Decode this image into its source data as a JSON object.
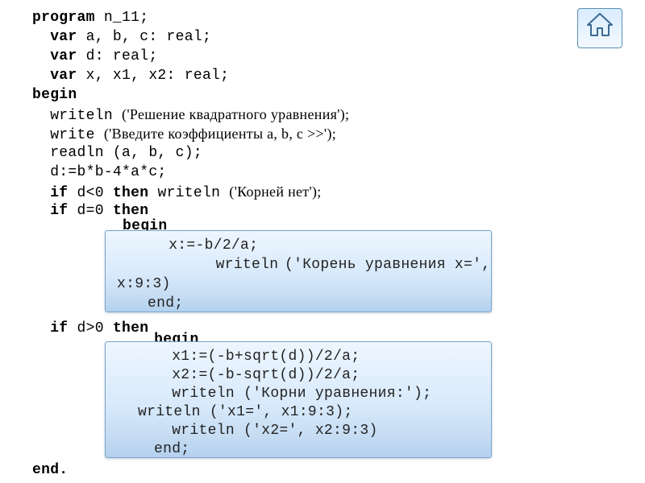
{
  "home": {
    "label": "home-button"
  },
  "code": {
    "l1_pre": "program",
    "l1_post": " n_11;",
    "l2_pre": "  var",
    "l2_post": " a, b, c: real;",
    "l3_pre": "  var",
    "l3_post": " d: real;",
    "l4_pre": "  var",
    "l4_post": " x, x1, x2: real;",
    "l5": "begin",
    "l6a": "  writeln ",
    "l6b": "('Решение квадратного уравнения');",
    "l7a": "  write ",
    "l7b": "('Введите коэффициенты a, b, c >>');",
    "l8": "  readln (a, b, c);",
    "l9": "  d:=b*b-4*a*c;",
    "l10a": "  if",
    "l10b": " d<0 ",
    "l10c": "then",
    "l10d": " writeln ",
    "l10e": "('Корней нет');",
    "l11a": "  if",
    "l11b": " d=0 ",
    "l11c": "then",
    "l12a": "  if",
    "l12b": " d>0 ",
    "l12c": "then",
    "l_end": "end."
  },
  "block1": {
    "b_begin": "begin",
    "b_x": "  x:=-b/2/a;",
    "b_w1a": "      writeln ",
    "b_w1b": "('Корень уравнения x=',",
    "b_tail": "x:9:3)",
    "b_end": "end;"
  },
  "block2": {
    "b_begin": " begin",
    "b_x1": "  x1:=(-b+sqrt(d))/2/a;",
    "b_x2": "  x2:=(-b-sqrt(d))/2/a;",
    "b_w1a": "  writeln",
    "b_w1b": " ('Корни уравнения:');",
    "b_w2": "writeln ('x1=', x1:9:3);",
    "b_w3": "  writeln ('x2=', x2:9:3)",
    "b_end": "end;"
  }
}
